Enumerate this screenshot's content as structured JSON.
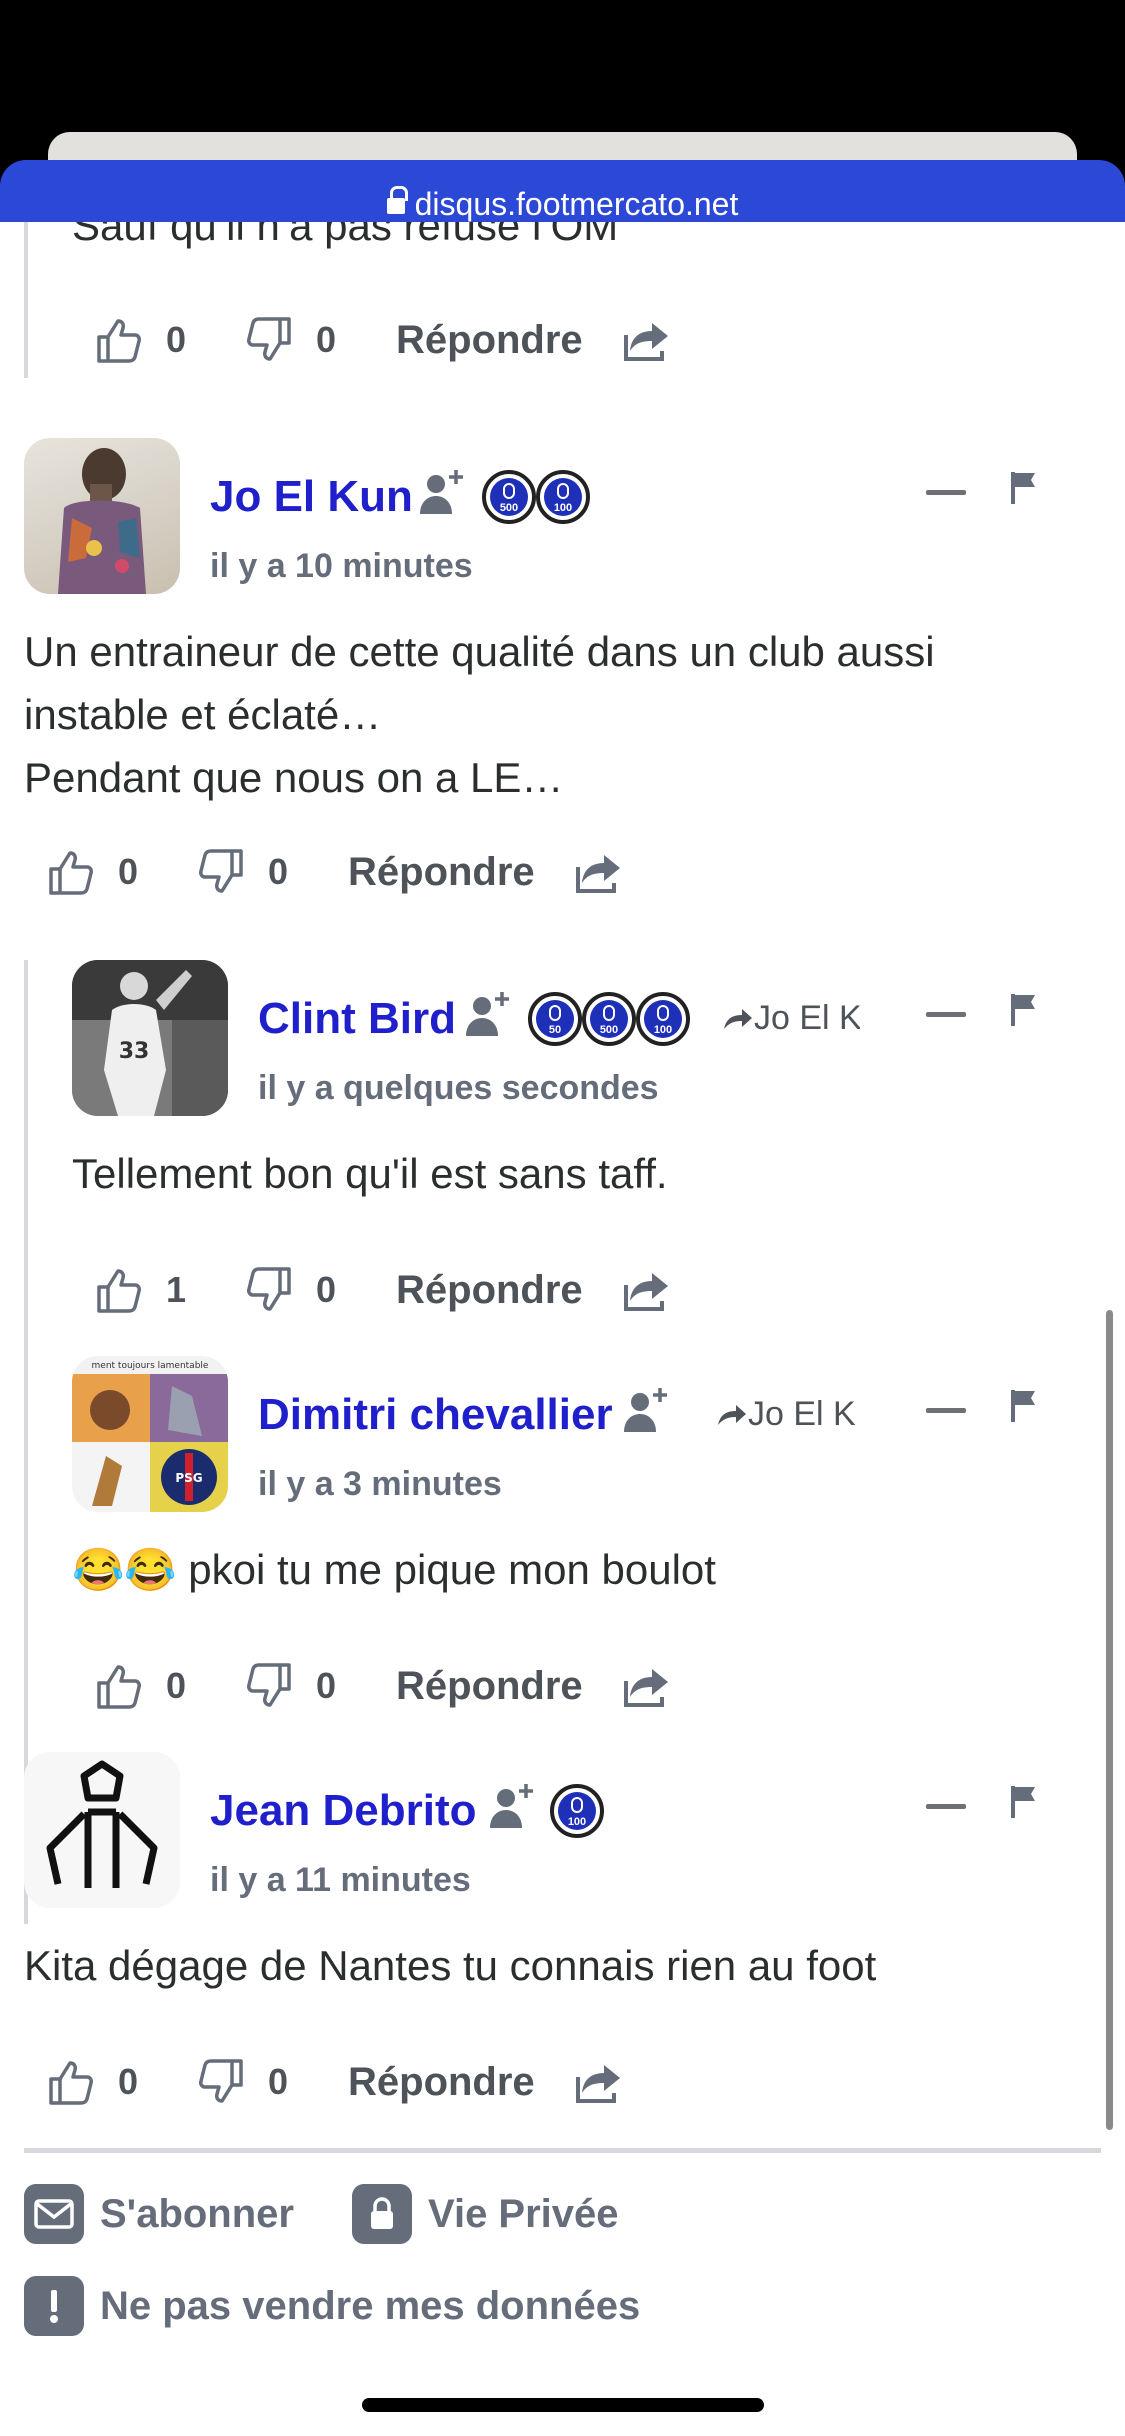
{
  "browser": {
    "url": "disqus.footmercato.net"
  },
  "top_partial_comment": {
    "text": "Sauf qu’il n’a pas refusé l’OM",
    "likes": "0",
    "dislikes": "0",
    "reply_label": "Répondre"
  },
  "comments": [
    {
      "author": "Jo El Kun",
      "time": "il y a 10 minutes",
      "badges": [
        "500",
        "100"
      ],
      "text_lines": [
        "Un entraineur de cette qualité dans un club aussi",
        "instable et éclaté…",
        "Pendant que nous on a LE…"
      ],
      "likes": "0",
      "dislikes": "0",
      "reply_label": "Répondre"
    },
    {
      "author": "Clint Bird",
      "time": "il y a quelques secondes",
      "badges": [
        "50",
        "500",
        "100"
      ],
      "reply_to": "Jo El K",
      "text": "Tellement bon qu'il est sans taff.",
      "likes": "1",
      "dislikes": "0",
      "reply_label": "Répondre"
    },
    {
      "author": "Dimitri chevallier",
      "time": "il y a 3 minutes",
      "reply_to": "Jo El K",
      "text": "😂😂 pkoi tu me pique mon boulot",
      "likes": "0",
      "dislikes": "0",
      "reply_label": "Répondre"
    },
    {
      "author": "Jean Debrito",
      "time": "il y a 11 minutes",
      "badges": [
        "100"
      ],
      "text": "Kita dégage de Nantes tu connais rien au foot",
      "likes": "0",
      "dislikes": "0",
      "reply_label": "Répondre"
    }
  ],
  "footer": {
    "subscribe": "S'abonner",
    "privacy": "Vie Privée",
    "do_not_sell": "Ne pas vendre mes données"
  },
  "colors": {
    "author_link": "#1f1fcc",
    "url_bar": "#2c48d6",
    "meta_text": "#656c7a"
  }
}
